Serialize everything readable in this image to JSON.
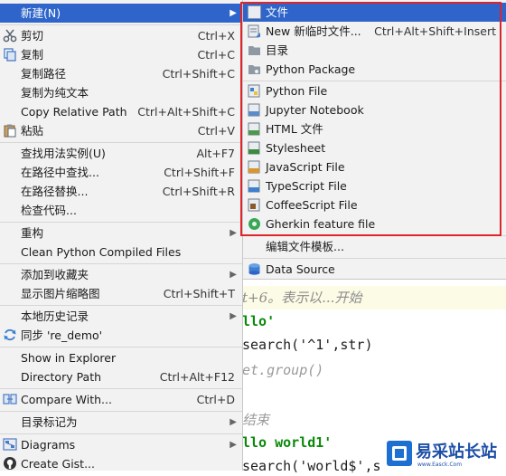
{
  "editor": {
    "line1": "t+6。表示以...开始",
    "line2": "llo'",
    "line3": "search('^1',str)",
    "line4": "et.group()",
    "line5": "结束",
    "line6": "llo world1'",
    "line7": "search('world$',s"
  },
  "context_menu": {
    "items": [
      {
        "label": "新建(N)",
        "shortcut": "",
        "icon": "none",
        "submenu": true,
        "active": true
      },
      {
        "label": "剪切",
        "shortcut": "Ctrl+X",
        "icon": "scissors-icon"
      },
      {
        "label": "复制",
        "shortcut": "Ctrl+C",
        "icon": "copy-icon"
      },
      {
        "label": "复制路径",
        "shortcut": "Ctrl+Shift+C",
        "icon": "none"
      },
      {
        "label": "复制为纯文本",
        "shortcut": "",
        "icon": "none"
      },
      {
        "label": "Copy Relative Path",
        "shortcut": "Ctrl+Alt+Shift+C",
        "icon": "none"
      },
      {
        "label": "粘贴",
        "shortcut": "Ctrl+V",
        "icon": "paste-icon"
      },
      {
        "label": "查找用法实例(U)",
        "shortcut": "Alt+F7",
        "icon": "none"
      },
      {
        "label": "在路径中查找...",
        "shortcut": "Ctrl+Shift+F",
        "icon": "none"
      },
      {
        "label": "在路径替换...",
        "shortcut": "Ctrl+Shift+R",
        "icon": "none"
      },
      {
        "label": "检查代码...",
        "shortcut": "",
        "icon": "none"
      },
      {
        "label": "重构",
        "shortcut": "",
        "icon": "none",
        "submenu": true
      },
      {
        "label": "Clean Python Compiled Files",
        "shortcut": "",
        "icon": "none"
      },
      {
        "label": "添加到收藏夹",
        "shortcut": "",
        "icon": "none",
        "submenu": true
      },
      {
        "label": "显示图片缩略图",
        "shortcut": "Ctrl+Shift+T",
        "icon": "none"
      },
      {
        "label": "本地历史记录",
        "shortcut": "",
        "icon": "none",
        "submenu": true
      },
      {
        "label": "同步 're_demo'",
        "shortcut": "",
        "icon": "sync-icon"
      },
      {
        "label": "Show in Explorer",
        "shortcut": "",
        "icon": "none"
      },
      {
        "label": "Directory Path",
        "shortcut": "Ctrl+Alt+F12",
        "icon": "none"
      },
      {
        "label": "Compare With...",
        "shortcut": "Ctrl+D",
        "icon": "compare-icon"
      },
      {
        "label": "目录标记为",
        "shortcut": "",
        "icon": "none",
        "submenu": true
      },
      {
        "label": "Diagrams",
        "shortcut": "",
        "icon": "diagram-icon",
        "submenu": true
      },
      {
        "label": "Create Gist...",
        "shortcut": "",
        "icon": "github-icon"
      }
    ]
  },
  "submenu_new": {
    "items": [
      {
        "label": "文件",
        "shortcut": "",
        "icon": "file-icon",
        "active": true
      },
      {
        "label": "New 新临时文件...",
        "shortcut": "Ctrl+Alt+Shift+Insert",
        "icon": "scratch-file-icon"
      },
      {
        "label": "目录",
        "shortcut": "",
        "icon": "folder-icon"
      },
      {
        "label": "Python Package",
        "shortcut": "",
        "icon": "package-folder-icon"
      },
      {
        "label": "Python File",
        "shortcut": "",
        "icon": "python-file-icon"
      },
      {
        "label": "Jupyter Notebook",
        "shortcut": "",
        "icon": "jupyter-icon"
      },
      {
        "label": "HTML 文件",
        "shortcut": "",
        "icon": "html-file-icon"
      },
      {
        "label": "Stylesheet",
        "shortcut": "",
        "icon": "css-file-icon"
      },
      {
        "label": "JavaScript File",
        "shortcut": "",
        "icon": "js-file-icon"
      },
      {
        "label": "TypeScript File",
        "shortcut": "",
        "icon": "ts-file-icon"
      },
      {
        "label": "CoffeeScript File",
        "shortcut": "",
        "icon": "coffee-file-icon"
      },
      {
        "label": "Gherkin feature file",
        "shortcut": "",
        "icon": "gherkin-icon"
      },
      {
        "label": "编辑文件模板...",
        "shortcut": "",
        "icon": "none"
      },
      {
        "label": "Data Source",
        "shortcut": "",
        "icon": "database-icon"
      }
    ]
  },
  "watermark": {
    "title": "易采站长站",
    "subtitle": "www.Easck.Com"
  },
  "colors": {
    "menu_bg": "#f2f2f2",
    "selection": "#2f65ca",
    "highlight_border": "#e0252a"
  }
}
